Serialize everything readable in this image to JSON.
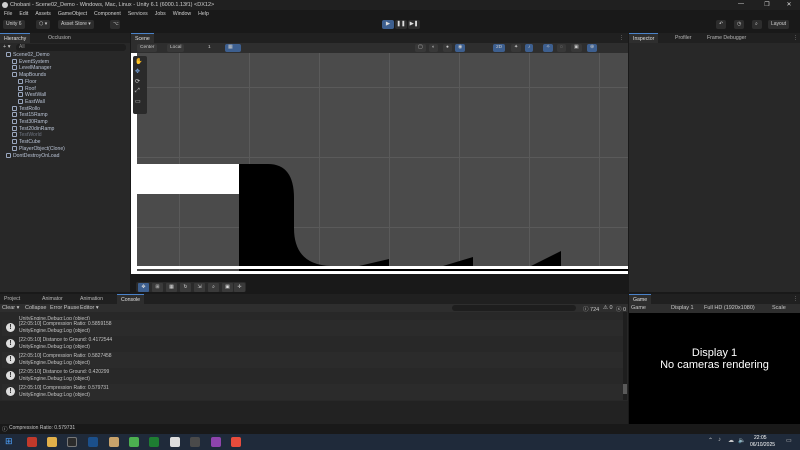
{
  "window": {
    "title": "Chobani - Scene02_Demo - Windows, Mac, Linux - Unity 6.1 (6000.1.13f1) <DX12>",
    "controls": [
      "—",
      "❐",
      "✕"
    ]
  },
  "menu": [
    "File",
    "Edit",
    "Assets",
    "GameObject",
    "Component",
    "Services",
    "Jobs",
    "Window",
    "Help"
  ],
  "toolbar": {
    "account": "Unity 6",
    "collab": "⬡ ▾",
    "asset_store": "Asset Store ▾",
    "layout": "Layout",
    "play_icons": [
      "▶",
      "❚❚",
      "▶❚"
    ]
  },
  "hierarchy": {
    "tabs": [
      "Hierarchy",
      "Occlusion"
    ],
    "add_label": "+ ▾",
    "search_placeholder": "All",
    "items": [
      {
        "label": "Scene02_Demo",
        "indent": 0,
        "dim": false
      },
      {
        "label": "EventSystem",
        "indent": 1,
        "dim": false
      },
      {
        "label": "LevelManager",
        "indent": 1,
        "dim": false
      },
      {
        "label": "MapBounds",
        "indent": 1,
        "dim": false
      },
      {
        "label": "Floor",
        "indent": 2,
        "dim": false
      },
      {
        "label": "Roof",
        "indent": 2,
        "dim": false
      },
      {
        "label": "WestWall",
        "indent": 2,
        "dim": false
      },
      {
        "label": "EastWall",
        "indent": 2,
        "dim": false
      },
      {
        "label": "TestRollo",
        "indent": 1,
        "dim": false
      },
      {
        "label": "Test15Ramp",
        "indent": 1,
        "dim": false
      },
      {
        "label": "Test30Ramp",
        "indent": 1,
        "dim": false
      },
      {
        "label": "Test20dinRamp",
        "indent": 1,
        "dim": false
      },
      {
        "label": "TestWorld",
        "indent": 1,
        "dim": true
      },
      {
        "label": "TestCube",
        "indent": 1,
        "dim": false
      },
      {
        "label": "PlayerObject(Clone)",
        "indent": 1,
        "dim": false
      },
      {
        "label": "DontDestroyOnLoad",
        "indent": 0,
        "dim": false
      }
    ]
  },
  "scene": {
    "tab": "Scene",
    "pivot": "Center",
    "space": "Local",
    "grid_count": "1"
  },
  "inspector": {
    "tabs": [
      "Inspector",
      "Profiler",
      "Frame Debugger"
    ]
  },
  "bottom": {
    "tabs": [
      "Project",
      "Animator",
      "Animation",
      "Console"
    ],
    "console_toolbar": [
      "Clear ▾",
      "Collapse",
      "Error Pause",
      "Editor ▾"
    ],
    "count": "724",
    "counts": [
      "0",
      "0"
    ],
    "entries": [
      {
        "line1": "UnityEngine.Debug:Log (object)",
        "line2": ""
      },
      {
        "line1": "[22:05:10] Compression Ratio: 0.5859158",
        "line2": "UnityEngine.Debug:Log (object)"
      },
      {
        "line1": "[22:05:10] Distance to Ground: 0.4172544",
        "line2": "UnityEngine.Debug:Log (object)"
      },
      {
        "line1": "[22:05:10] Compression Ratio: 0.5827458",
        "line2": "UnityEngine.Debug:Log (object)"
      },
      {
        "line1": "[22:05:10] Distance to Ground: 0.420299",
        "line2": "UnityEngine.Debug:Log (object)"
      },
      {
        "line1": "[22:05:10] Compression Ratio: 0.579731",
        "line2": "UnityEngine.Debug:Log (object)"
      }
    ]
  },
  "game": {
    "tab": "Game",
    "mode": "Game",
    "display": "Display 1",
    "resolution": "Full HD (1920x1080)",
    "scale": "Scale",
    "msg1": "Display 1",
    "msg2": "No cameras rendering"
  },
  "status": {
    "text": "Compression Ratio: 0.579731"
  },
  "taskbar": {
    "time": "22:05",
    "date": "06/10/2025"
  }
}
